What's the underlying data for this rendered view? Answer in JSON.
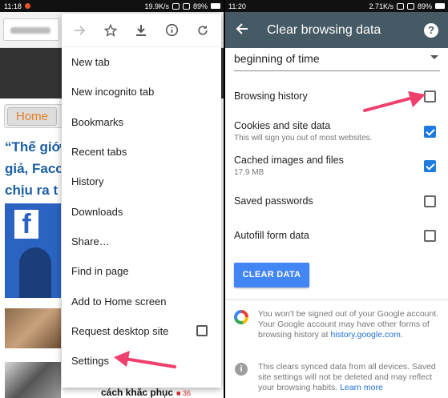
{
  "left": {
    "status": {
      "time": "11:18",
      "speed": "19.9K/s",
      "battery": "89%"
    },
    "site": {
      "home_label": "Home",
      "headline_lines": [
        "“Thế giớ",
        "giả, Facc",
        "chịu ra t"
      ],
      "bottom_caption": "cách khắc phục",
      "bottom_count": "36"
    },
    "menu": {
      "toolbar_icons": [
        "forward-arrow-icon",
        "star-icon",
        "download-icon",
        "info-icon",
        "refresh-icon"
      ],
      "items": [
        {
          "label": "New tab"
        },
        {
          "label": "New incognito tab"
        },
        {
          "label": "Bookmarks"
        },
        {
          "label": "Recent tabs"
        },
        {
          "label": "History"
        },
        {
          "label": "Downloads"
        },
        {
          "label": "Share…"
        },
        {
          "label": "Find in page"
        },
        {
          "label": "Add to Home screen"
        },
        {
          "label": "Request desktop site",
          "checkbox": false
        },
        {
          "label": "Settings"
        }
      ]
    }
  },
  "right": {
    "status": {
      "time": "11:20",
      "speed": "2.71K/s",
      "battery": "89%"
    },
    "appbar": {
      "title": "Clear browsing data",
      "help": "?"
    },
    "range": "beginning of time",
    "options": [
      {
        "label": "Browsing history",
        "sub": "",
        "checked": false
      },
      {
        "label": "Cookies and site data",
        "sub": "This will sign you out of most websites.",
        "checked": true
      },
      {
        "label": "Cached images and files",
        "sub": "17.9 MB",
        "checked": true
      },
      {
        "label": "Saved passwords",
        "sub": "",
        "checked": false
      },
      {
        "label": "Autofill form data",
        "sub": "",
        "checked": false
      }
    ],
    "clear_button": "CLEAR DATA",
    "google_note": "You won't be signed out of your Google account. Your Google account may have other forms of browsing history at ",
    "google_link": "history.google.com",
    "google_note_end": ".",
    "sync_note": "This clears synced data from all devices. Saved site settings will not be deleted and may reflect your browsing habits. ",
    "sync_link": "Learn more",
    "colors": {
      "appbar": "#455a64",
      "accent": "#1e7ae0",
      "button": "#4285f4",
      "arrow": "#f0406e"
    }
  }
}
